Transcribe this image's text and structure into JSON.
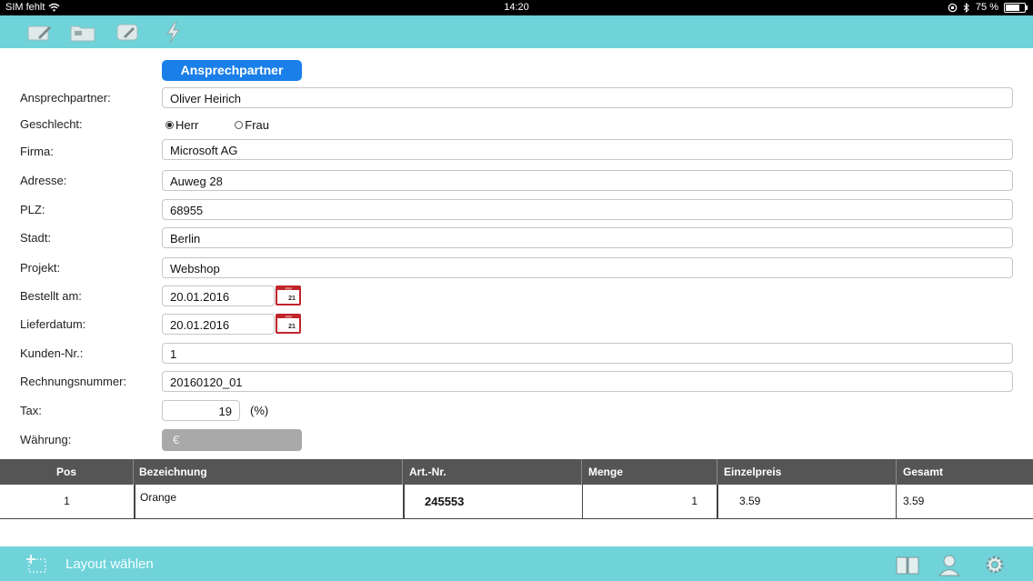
{
  "statusbar": {
    "carrier": "SIM fehlt",
    "time": "14:20",
    "battery": "75 %",
    "battery_level": 0.75
  },
  "toolbar": {
    "icons": [
      "edit-icon",
      "folder-icon",
      "chat-edit-icon",
      "lightning-icon"
    ]
  },
  "form": {
    "section_button": "Ansprechpartner",
    "fields": {
      "contact": {
        "label": "Ansprechpartner:",
        "value": "Oliver Heirich"
      },
      "gender": {
        "label": "Geschlecht:",
        "options": [
          "Herr",
          "Frau"
        ],
        "selected": "Herr"
      },
      "company": {
        "label": "Firma:",
        "value": "Microsoft AG"
      },
      "address": {
        "label": "Adresse:",
        "value": "Auweg 28"
      },
      "zip": {
        "label": "PLZ:",
        "value": "68955"
      },
      "city": {
        "label": "Stadt:",
        "value": "Berlin"
      },
      "project": {
        "label": "Projekt:",
        "value": "Webshop"
      },
      "ordered": {
        "label": "Bestellt am:",
        "value": "20.01.2016"
      },
      "delivery": {
        "label": "Lieferdatum:",
        "value": "20.01.2016"
      },
      "customer_no": {
        "label": "Kunden-Nr.:",
        "value": "1"
      },
      "invoice_no": {
        "label": "Rechnungsnummer:",
        "value": "20160120_01"
      },
      "tax": {
        "label": "Tax:",
        "value": "19",
        "unit": "(%)"
      },
      "currency": {
        "label": "Währung:",
        "value": "€"
      }
    },
    "calendar_icon": {
      "month": "JAN",
      "day": "21"
    }
  },
  "table": {
    "headers": [
      "Pos",
      "Bezeichnung",
      "Art.-Nr.",
      "Menge",
      "Einzelpreis",
      "Gesamt"
    ],
    "rows": [
      [
        "1",
        "Orange",
        "245553",
        "1",
        "3.59",
        "3.59"
      ]
    ]
  },
  "bottombar": {
    "layout_label": "Layout wählen",
    "icons": [
      "layout-add-icon",
      "book-icon",
      "user-icon",
      "settings-icon"
    ]
  },
  "colors": {
    "toolbar": "#6fd3d9",
    "button": "#1a7fe8",
    "header": "#555555",
    "calendar": "#c0242a"
  }
}
